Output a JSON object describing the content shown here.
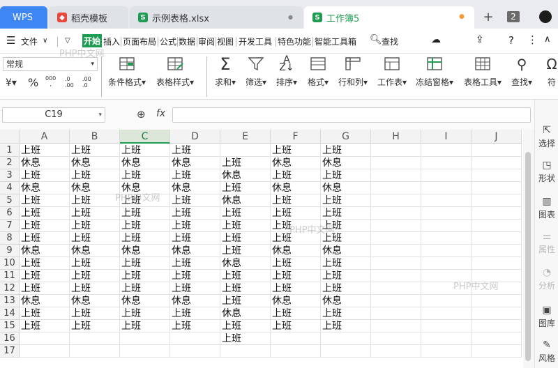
{
  "tabs": {
    "wps": "WPS",
    "daoke": "稻壳模板",
    "sample": "示例表格.xlsx",
    "workbook": "工作簿5",
    "new_tab": "+",
    "count": "2"
  },
  "menu": {
    "file": "文件",
    "items": [
      "开始",
      "插入",
      "页面布局",
      "公式",
      "数据",
      "审阅",
      "视图",
      "开发工具",
      "特色功能",
      "智能工具箱"
    ],
    "search": "查找",
    "help": "?"
  },
  "ribbon": {
    "font_value": "常规",
    "percent": "%",
    "thousands": "000",
    "inc_decimal": ".0\n.00",
    "dec_decimal": ".00\n.0",
    "buttons": [
      "条件格式",
      "表格样式",
      "求和",
      "筛选",
      "排序",
      "格式",
      "行和列",
      "工作表",
      "冻结窗格",
      "表格工具",
      "查找",
      "符"
    ]
  },
  "formula_bar": {
    "cell_ref": "C19",
    "fx": "fx",
    "value": ""
  },
  "columns": [
    "A",
    "B",
    "C",
    "D",
    "E",
    "F",
    "G",
    "H",
    "I",
    "J"
  ],
  "rows": [
    [
      "上班",
      "上班",
      "上班",
      "上班",
      "",
      "上班",
      "上班"
    ],
    [
      "休息",
      "休息",
      "休息",
      "休息",
      "上班",
      "休息",
      "休息"
    ],
    [
      "上班",
      "上班",
      "上班",
      "上班",
      "休息",
      "上班",
      "上班"
    ],
    [
      "休息",
      "休息",
      "休息",
      "休息",
      "上班",
      "休息",
      "休息"
    ],
    [
      "上班",
      "上班",
      "上班",
      "上班",
      "休息",
      "上班",
      "上班"
    ],
    [
      "上班",
      "上班",
      "上班",
      "上班",
      "上班",
      "上班",
      "上班"
    ],
    [
      "上班",
      "上班",
      "上班",
      "上班",
      "上班",
      "上班",
      "上班"
    ],
    [
      "上班",
      "上班",
      "上班",
      "上班",
      "上班",
      "上班",
      "上班"
    ],
    [
      "休息",
      "休息",
      "休息",
      "休息",
      "上班",
      "休息",
      "休息"
    ],
    [
      "上班",
      "上班",
      "上班",
      "上班",
      "休息",
      "上班",
      "上班"
    ],
    [
      "上班",
      "上班",
      "上班",
      "上班",
      "上班",
      "上班",
      "上班"
    ],
    [
      "上班",
      "上班",
      "上班",
      "上班",
      "上班",
      "上班",
      "上班"
    ],
    [
      "休息",
      "休息",
      "休息",
      "休息",
      "上班",
      "休息",
      "休息"
    ],
    [
      "上班",
      "上班",
      "上班",
      "上班",
      "休息",
      "上班",
      "上班"
    ],
    [
      "上班",
      "上班",
      "上班",
      "上班",
      "上班",
      "上班",
      "上班"
    ],
    [
      "",
      "",
      "",
      "",
      "上班",
      "",
      ""
    ],
    [
      "",
      "",
      "",
      "",
      "",
      "",
      ""
    ]
  ],
  "right_panel": [
    "选择",
    "形状",
    "图表",
    "属性",
    "分析",
    "图库",
    "风格"
  ],
  "watermark": "PHP中文网",
  "colors": {
    "wps_blue": "#3f86f5",
    "green": "#1e9c52",
    "active_tab_dot": "#f29a38"
  }
}
